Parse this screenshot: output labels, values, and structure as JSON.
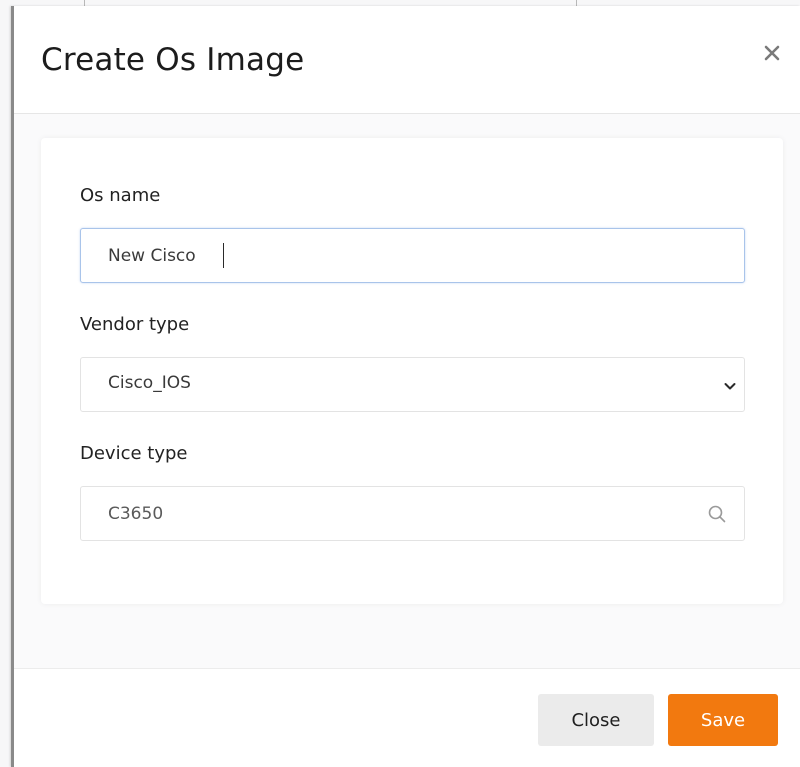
{
  "modal": {
    "title": "Create Os Image",
    "close_icon": "close-icon"
  },
  "form": {
    "os_name": {
      "label": "Os name",
      "value": "New Cisco"
    },
    "vendor_type": {
      "label": "Vendor type",
      "selected": "Cisco_IOS",
      "icon": "chevron-down-icon"
    },
    "device_type": {
      "label": "Device type",
      "value": "C3650",
      "icon": "search-icon"
    }
  },
  "footer": {
    "close_label": "Close",
    "save_label": "Save"
  },
  "colors": {
    "accent": "#f2790f",
    "focus_border": "#a9c4ea",
    "secondary_button": "#ebebeb"
  }
}
